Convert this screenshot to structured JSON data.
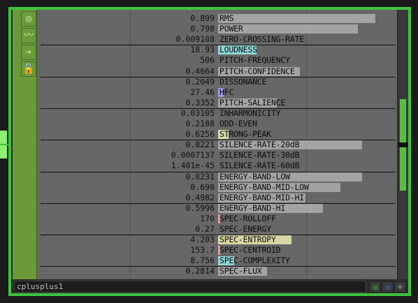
{
  "operator": {
    "name": "cplusplus1"
  },
  "colors": {
    "frame": "#3dc43d",
    "bar_default": "#a3a3a3",
    "bar_cyan": "#8fd6d6",
    "bar_blue": "#9a9ae6",
    "bar_yellow": "#d6d6a3",
    "bar_pink": "#e69a9a"
  },
  "toolbar_icons": [
    "target-icon",
    "graph-icon",
    "arrow-right-icon",
    "lock-open-icon"
  ],
  "rows": [
    {
      "value": "0.899",
      "label": "RMS",
      "level": 0.899,
      "color": "#a3a3a3"
    },
    {
      "value": "0.798",
      "label": "POWER",
      "level": 0.798,
      "color": "#a3a3a3"
    },
    {
      "value": "0.009108",
      "label": "ZERO-CROSSING-RATE",
      "level": 0.0,
      "color": "#a3a3a3",
      "sep": true
    },
    {
      "value": "18.93",
      "label": "LOUDNESS",
      "level": 0.22,
      "color": "#8fd6d6"
    },
    {
      "value": "506",
      "label": "PITCH-FREQUENCY",
      "level": 0.0,
      "color": "#a3a3a3"
    },
    {
      "value": "0.4664",
      "label": "PITCH-CONFIDENCE",
      "level": 0.4664,
      "color": "#a3a3a3",
      "sep": true
    },
    {
      "value": "0.2049",
      "label": "DISSONANCE",
      "level": 0.0,
      "color": "#a3a3a3"
    },
    {
      "value": "27.46",
      "label": "HFC",
      "level": 0.03,
      "color": "#9a9ae6"
    },
    {
      "value": "0.3352",
      "label": "PITCH-SALIENCE",
      "level": 0.3352,
      "color": "#a3a3a3",
      "sep": true
    },
    {
      "value": "0.03105",
      "label": "INHARMONICITY",
      "level": 0.0,
      "color": "#a3a3a3"
    },
    {
      "value": "0.2188",
      "label": "ODD-EVEN",
      "level": 0.0,
      "color": "#a3a3a3"
    },
    {
      "value": "0.6256",
      "label": "STRONG-PEAK",
      "level": 0.06,
      "color": "#d6d6a3",
      "sep": true
    },
    {
      "value": "0.8221",
      "label": "SILENCE-RATE-20dB",
      "level": 0.8221,
      "color": "#a3a3a3"
    },
    {
      "value": "0.0007137",
      "label": "SILENCE-RATE-30dB",
      "level": 0.0,
      "color": "#a3a3a3"
    },
    {
      "value": "1.401e-45",
      "label": "SILENCE-RATE-60dB",
      "level": 0.0,
      "color": "#a3a3a3",
      "sep": true
    },
    {
      "value": "0.8231",
      "label": "ENERGY-BAND-LOW",
      "level": 0.8231,
      "color": "#a3a3a3"
    },
    {
      "value": "0.698",
      "label": "ENERGY-BAND-MID-LOW",
      "level": 0.698,
      "color": "#a3a3a3"
    },
    {
      "value": "0.4982",
      "label": "ENERGY-BAND-MID-HI",
      "level": 0.4982,
      "color": "#a3a3a3",
      "sep": true
    },
    {
      "value": "0.5996",
      "label": "ENERGY-BAND-HI",
      "level": 0.5996,
      "color": "#a3a3a3"
    },
    {
      "value": "170",
      "label": "SPEC-ROLLOFF",
      "level": 0.01,
      "color": "#e69a9a"
    },
    {
      "value": "0.27",
      "label": "SPEC-ENERGY",
      "level": 0.0,
      "color": "#a3a3a3",
      "sep": true
    },
    {
      "value": "4.203",
      "label": "SPEC-ENTROPY",
      "level": 0.42,
      "color": "#d6d6a3"
    },
    {
      "value": "153.7",
      "label": "SPEC-CENTROID",
      "level": 0.01,
      "color": "#e69a9a"
    },
    {
      "value": "8.756",
      "label": "SPEC-COMPLEXITY",
      "level": 0.09,
      "color": "#8fd6d6",
      "sep": true
    },
    {
      "value": "0.2814",
      "label": "SPEC-FLUX",
      "level": 0.2814,
      "color": "#a3a3a3"
    }
  ]
}
